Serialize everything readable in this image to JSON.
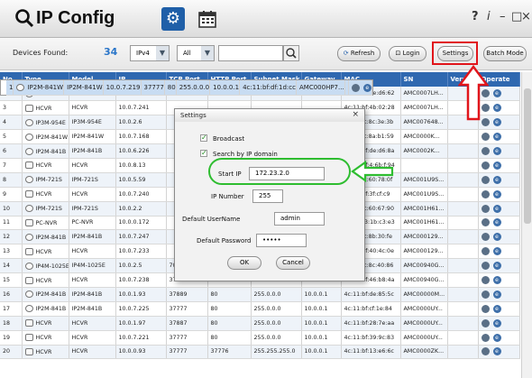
{
  "app": {
    "title": "IP Config",
    "window_controls": [
      "?",
      "i",
      "–",
      "□",
      "×"
    ]
  },
  "toolbar": {
    "devices_found_label": "Devices Found:",
    "devices_found_count": "34",
    "ip_version": "IPv4",
    "filter": "All",
    "search_value": "",
    "refresh_label": "Refresh",
    "login_label": "Login",
    "settings_label": "Settings",
    "batch_mode_label": "Batch Mode"
  },
  "table": {
    "headers": [
      "No.",
      "Type",
      "Model",
      "IP",
      "TCP Port",
      "HTTP Port",
      "Subnet Mask",
      "Gateway",
      "MAC",
      "SN",
      "Version",
      "Operate"
    ],
    "rows": [
      [
        "1",
        "IP2M-841W",
        "IP2M-841W",
        "10.0.7.219",
        "37777",
        "80",
        "255.0.0.0",
        "10.0.0.1",
        "4c:11:bf:df:1d:cc",
        "AMC000HP7...",
        "",
        ""
      ],
      [
        "2",
        "IP2M-841B",
        "IP2M-841B",
        "10.0.7.15",
        "7006",
        "7006",
        "255.0.0.0",
        "",
        "4c:11:bf:de:d6:62",
        "AMC0007LH...",
        "",
        ""
      ],
      [
        "3",
        "HCVR",
        "HCVR",
        "10.0.7.241",
        "",
        "",
        "",
        "",
        "4c:11:bf:4b:02:28",
        "AMC0007LH...",
        "",
        ""
      ],
      [
        "4",
        "IP3M-954E",
        "IP3M-954E",
        "10.0.2.6",
        "",
        "",
        "",
        "",
        "3c:ef:8c:8c:3e:3b",
        "AMC007648...",
        "",
        ""
      ],
      [
        "5",
        "IP2M-841W",
        "IP2M-841W",
        "10.0.7.168",
        "",
        "",
        "",
        "",
        "3c:ef:8c:8a:b1:59",
        "AMC0000K...",
        "",
        ""
      ],
      [
        "6",
        "IP2M-841B",
        "IP2M-841B",
        "10.0.6.226",
        "",
        "",
        "",
        "",
        "4c:11:bf:de:d6:8a",
        "AMC0002K...",
        "",
        ""
      ],
      [
        "7",
        "HCVR",
        "HCVR",
        "10.0.8.13",
        "",
        "",
        "",
        "",
        "4c:11:bf:4:6b:f:94",
        "",
        "",
        ""
      ],
      [
        "8",
        "IPM-721S",
        "IPM-721S",
        "10.0.5.59",
        "",
        "",
        "",
        "",
        "3c:ef:8c:60:78:0f",
        "AMC001U9S...",
        "",
        ""
      ],
      [
        "9",
        "HCVR",
        "HCVR",
        "10.0.7.240",
        "",
        "",
        "",
        "",
        "4c:11:bf:3f:cf:c9",
        "AMC001U9S...",
        "",
        ""
      ],
      [
        "10",
        "IPM-721S",
        "IPM-721S",
        "10.0.2.2",
        "",
        "",
        "",
        "",
        "3c:ef:8c:60:67:90",
        "AMC001H61...",
        "",
        ""
      ],
      [
        "11",
        "PC-NVR",
        "PC-NVR",
        "10.0.0.172",
        "",
        "",
        "",
        "",
        "00:55:f3:1b:c3:e3",
        "AMC001H61...",
        "",
        ""
      ],
      [
        "12",
        "IP2M-841B",
        "IP2M-841B",
        "10.0.7.247",
        "",
        "",
        "",
        "",
        "3c:ef:8c:8b:30:fe",
        "AMC000129...",
        "",
        ""
      ],
      [
        "13",
        "HCVR",
        "HCVR",
        "10.0.7.233",
        "",
        "",
        "",
        "",
        "4c:11:bf:40:4c:0e",
        "AMC000129...",
        "",
        ""
      ],
      [
        "14",
        "IP4M-1025E",
        "IP4M-1025E",
        "10.0.2.5",
        "7014",
        "7012",
        "255.0.0.0",
        "10.0.0.1",
        "3c:ef:8c:8c:40:86",
        "AMC00940G...",
        "",
        ""
      ],
      [
        "15",
        "HCVR",
        "HCVR",
        "10.0.7.238",
        "37777",
        "80",
        "255.0.0.0",
        "10.0.0.1",
        "4c:11:bf:46:b8:4a",
        "AMC00940G...",
        "",
        ""
      ],
      [
        "16",
        "IP2M-841B",
        "IP2M-841B",
        "10.0.1.93",
        "37889",
        "80",
        "255.0.0.0",
        "10.0.0.1",
        "4c:11:bf:de:85:5c",
        "AMC00000M...",
        "",
        ""
      ],
      [
        "17",
        "IP2M-841B",
        "IP2M-841B",
        "10.0.7.225",
        "37777",
        "80",
        "255.0.0.0",
        "10.0.0.1",
        "4c:11:bf:cf:1e:84",
        "AMC0000UY...",
        "",
        ""
      ],
      [
        "18",
        "HCVR",
        "HCVR",
        "10.0.1.97",
        "37887",
        "80",
        "255.0.0.0",
        "10.0.0.1",
        "4c:11:bf:28:7e:aa",
        "AMC0000UY...",
        "",
        ""
      ],
      [
        "19",
        "HCVR",
        "HCVR",
        "10.0.7.221",
        "37777",
        "80",
        "255.0.0.0",
        "10.0.0.1",
        "4c:11:bf:39:9c:83",
        "AMC0000UY...",
        "",
        ""
      ],
      [
        "20",
        "HCVR",
        "HCVR",
        "10.0.0.93",
        "37777",
        "37776",
        "255.255.255.0",
        "10.0.0.1",
        "4c:11:bf:13:e6:6c",
        "AMC0000ZK...",
        "",
        ""
      ]
    ]
  },
  "dialog": {
    "title": "Settings",
    "close": "×",
    "broadcast_label": "Broadcast",
    "search_by_ip_label": "Search by IP domain",
    "start_ip_label": "Start IP",
    "start_ip_value": "172.23.2.0",
    "ip_number_label": "IP Number",
    "ip_number_value": "255",
    "default_username_label": "Default UserName",
    "default_username_value": "admin",
    "default_password_label": "Default Password",
    "default_password_value": "•••••",
    "ok_label": "OK",
    "cancel_label": "Cancel"
  },
  "annotations": {
    "red_highlight_color": "#e1151b",
    "green_highlight_color": "#2ebd30"
  }
}
